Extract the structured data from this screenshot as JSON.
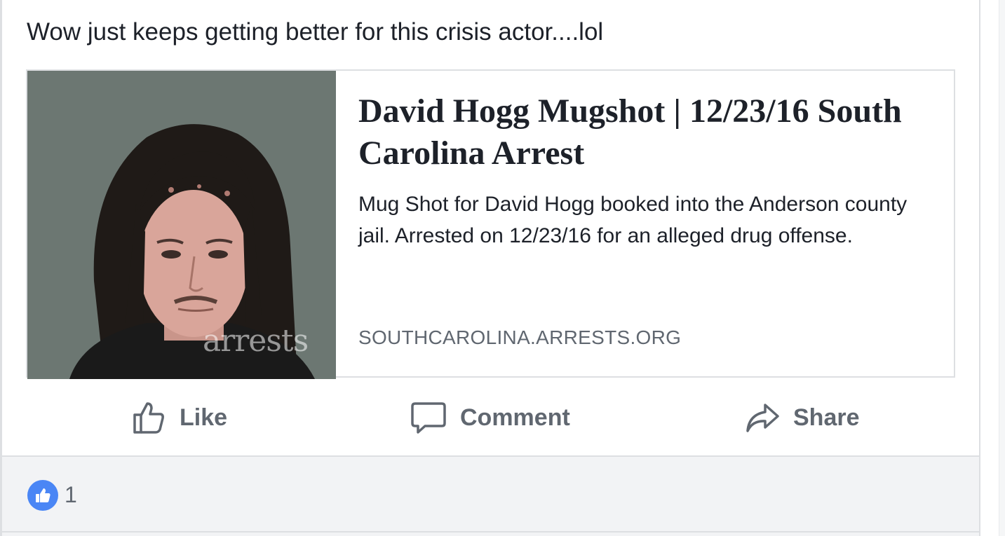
{
  "post": {
    "text": "Wow just keeps getting better for this crisis actor....lol"
  },
  "link_card": {
    "title": "David Hogg Mugshot | 12/23/16 South Carolina Arrest",
    "description": "Mug Shot for David Hogg booked into the Anderson county jail. Arrested on 12/23/16 for an alleged drug offense.",
    "domain": "SOUTHCAROLINA.ARRESTS.ORG",
    "image_watermark": "arrests"
  },
  "actions": {
    "like_label": "Like",
    "comment_label": "Comment",
    "share_label": "Share"
  },
  "reactions": {
    "icon": "thumbs-up-icon",
    "count": "1"
  },
  "colors": {
    "text": "#1d2129",
    "secondary_text": "#606770",
    "border": "#dddfe2",
    "reaction_blue": "#4a86f5",
    "reactions_bg": "#f2f3f5"
  }
}
